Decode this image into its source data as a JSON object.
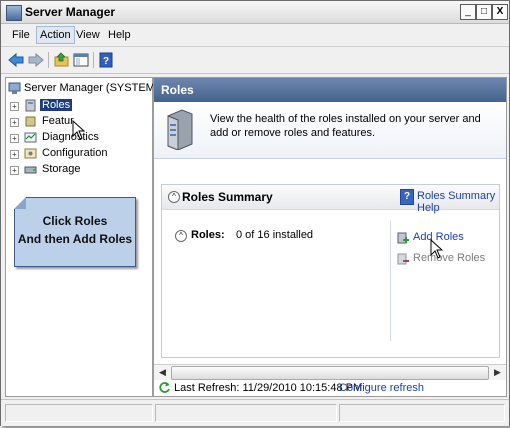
{
  "window": {
    "title": "Server Manager"
  },
  "titlebar_buttons": {
    "minimize": "_",
    "maximize": "□",
    "close": "X"
  },
  "menu": [
    {
      "label": "File"
    },
    {
      "label": "Action"
    },
    {
      "label": "View"
    },
    {
      "label": "Help"
    }
  ],
  "toolbar": {
    "icons": [
      "back-arrow-icon",
      "forward-arrow-icon",
      "up-folder-icon",
      "show-hide-tree-icon",
      "help-book-icon"
    ]
  },
  "tree": {
    "root": "Server Manager (SYSTEMDC)",
    "items": [
      {
        "label": "Roles",
        "selected": true
      },
      {
        "label": "Featur"
      },
      {
        "label": "Diagnostics"
      },
      {
        "label": "Configuration"
      },
      {
        "label": "Storage"
      }
    ]
  },
  "callout": {
    "line1": "Click Roles",
    "line2": "And then Add Roles"
  },
  "panel": {
    "header": "Roles",
    "description": "View the health of the roles installed on your server and add or remove roles and features."
  },
  "summary": {
    "title": "Roles Summary",
    "help_link": "Roles Summary Help",
    "roles_key": "Roles:",
    "roles_value": "0 of 16 installed",
    "actions": [
      {
        "label": "Add Roles",
        "enabled": true
      },
      {
        "label": "Remove Roles",
        "enabled": false
      }
    ]
  },
  "refresh": {
    "text": "Last Refresh: 11/29/2010 10:15:48 PM",
    "link": "Configure refresh"
  },
  "colors": {
    "header_blue": "#45638f",
    "link_blue": "#1a3fb5",
    "selection": "#1b3c83",
    "callout_fill": "#bdd0ea"
  }
}
